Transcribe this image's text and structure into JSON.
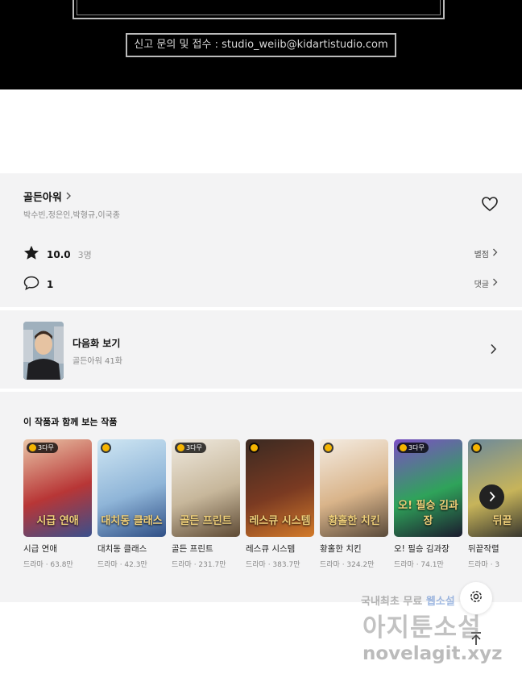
{
  "banner": {
    "contact": "신고 문의 및 접수 : studio_weiib@kidartistudio.com"
  },
  "work": {
    "title": "골든아워",
    "authors": "박수빈,정은인,박형규,이국종",
    "rating": "10.0",
    "rating_count": "3명",
    "rating_link": "별점",
    "comments": "1",
    "comments_link": "댓글"
  },
  "next_episode": {
    "label": "다음화 보기",
    "subtitle": "골든아워 41화"
  },
  "recommendations": {
    "heading": "이 작품과 함께 보는 작품",
    "items": [
      {
        "name": "시급 연애",
        "meta": "드라마 · 63.8만",
        "badge": "3다무",
        "cover_text": "시급 연애",
        "colors": [
          "#e9c4a6",
          "#b83636",
          "#3a4f8c"
        ]
      },
      {
        "name": "대치동 클래스",
        "meta": "드라마 · 42.3만",
        "badge": "",
        "cover_text": "대치동 클래스",
        "colors": [
          "#cfe6f3",
          "#8fb5d8",
          "#2f4f86"
        ]
      },
      {
        "name": "골든 프린트",
        "meta": "드라마 · 231.7만",
        "badge": "3다무",
        "cover_text": "골든 프린트",
        "colors": [
          "#efe9de",
          "#c7b79b",
          "#5e4a34"
        ]
      },
      {
        "name": "레스큐 시스템",
        "meta": "드라마 · 383.7만",
        "badge": "",
        "cover_text": "레스큐 시스템",
        "colors": [
          "#3b2a22",
          "#7a3a22",
          "#d27a2a"
        ]
      },
      {
        "name": "황홀한 치킨",
        "meta": "드라마 · 324.2만",
        "badge": "",
        "cover_text": "황홀한 치킨",
        "colors": [
          "#f4ece2",
          "#d9b48a",
          "#5a4a3a"
        ]
      },
      {
        "name": "오! 필승 김과장",
        "meta": "드라마 · 74.1만",
        "badge": "3다무",
        "cover_text": "오! 필승 김과장",
        "colors": [
          "#7b4fc4",
          "#2fa35a",
          "#1b1b2e"
        ]
      },
      {
        "name": "뒤끝작렬",
        "meta": "드라마 · 3",
        "badge": "",
        "cover_text": "뒤끝",
        "colors": [
          "#6d8a9b",
          "#c7b45a",
          "#2a2a2a"
        ]
      }
    ]
  },
  "watermark": {
    "line1": "국내최초 무료",
    "line1_accent": "웹소설",
    "line2": "아지툰소설",
    "line3": "novelagit.xyz"
  },
  "icons": {
    "heart": "heart-outline-icon",
    "star": "star-icon",
    "comment": "comment-bubble-icon",
    "chevron": "chevron-right-icon",
    "settings": "gear-icon",
    "top": "arrow-up-icon"
  }
}
